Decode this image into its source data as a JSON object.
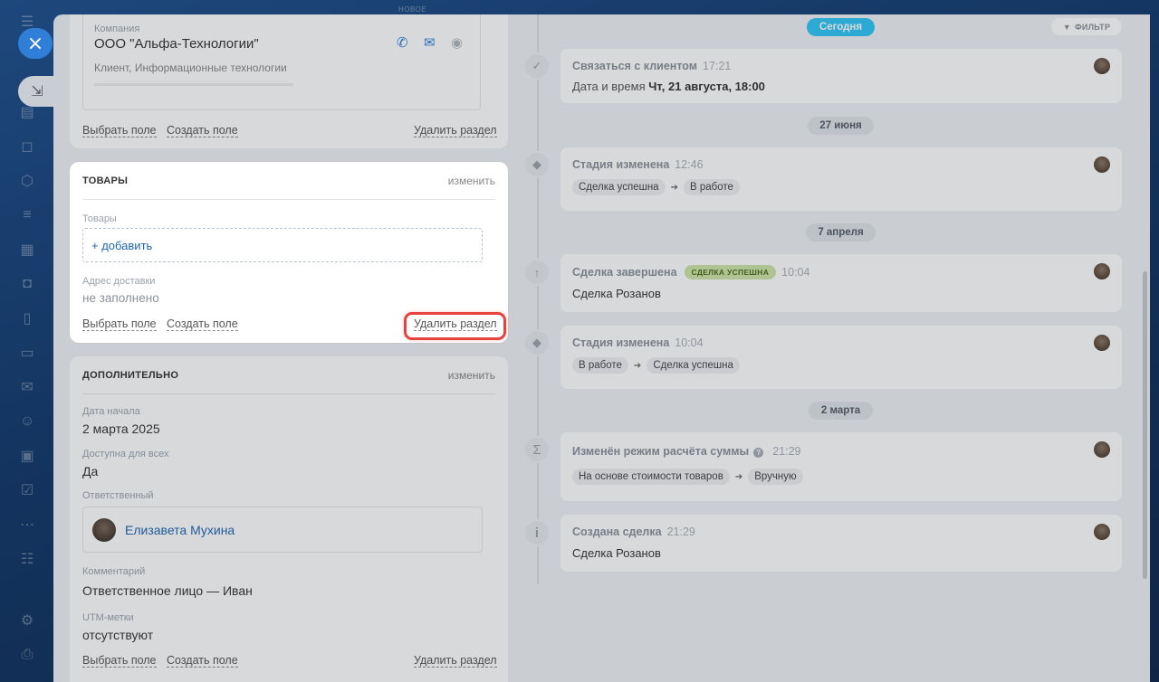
{
  "top": {
    "new_label": "НОВОЕ"
  },
  "company": {
    "label": "Компания",
    "name": "ООО \"Альфа-Технологии\"",
    "sub": "Клиент, Информационные технологии"
  },
  "section_actions": {
    "choose_field": "Выбрать поле",
    "create_field": "Создать поле",
    "delete_section": "Удалить раздел"
  },
  "products": {
    "title": "ТОВАРЫ",
    "edit": "изменить",
    "field_label": "Товары",
    "add": "+ добавить",
    "address_label": "Адрес доставки",
    "address_value": "не заполнено"
  },
  "additional": {
    "title": "ДОПОЛНИТЕЛЬНО",
    "edit": "изменить",
    "start_label": "Дата начала",
    "start_value": "2 марта 2025",
    "public_label": "Доступна для всех",
    "public_value": "Да",
    "responsible_label": "Ответственный",
    "responsible_name": "Елизавета Мухина",
    "comment_label": "Комментарий",
    "comment_value": "Ответственное лицо — Иван",
    "utm_label": "UTM-метки",
    "utm_value": "отсутствуют"
  },
  "timeline": {
    "today": "Сегодня",
    "filter": "ФИЛЬТР",
    "dates": [
      "27 июня",
      "7 апреля",
      "2 марта"
    ],
    "items": [
      {
        "title": "Связаться с клиентом",
        "time": "17:21",
        "body_label": "Дата и время",
        "body_value": "Чт, 21 августа, 18:00"
      },
      {
        "title": "Стадия изменена",
        "time": "12:46",
        "from": "Сделка успешна",
        "to": "В работе"
      },
      {
        "title": "Сделка завершена",
        "badge": "СДЕЛКА УСПЕШНА",
        "time": "10:04",
        "body": "Сделка Розанов"
      },
      {
        "title": "Стадия изменена",
        "time": "10:04",
        "from": "В работе",
        "to": "Сделка успешна"
      },
      {
        "title": "Изменён режим расчёта суммы",
        "time": "21:29",
        "from": "На основе стоимости товаров",
        "to": "Вручную"
      },
      {
        "title": "Создана сделка",
        "time": "21:29",
        "body": "Сделка Розанов"
      }
    ]
  }
}
